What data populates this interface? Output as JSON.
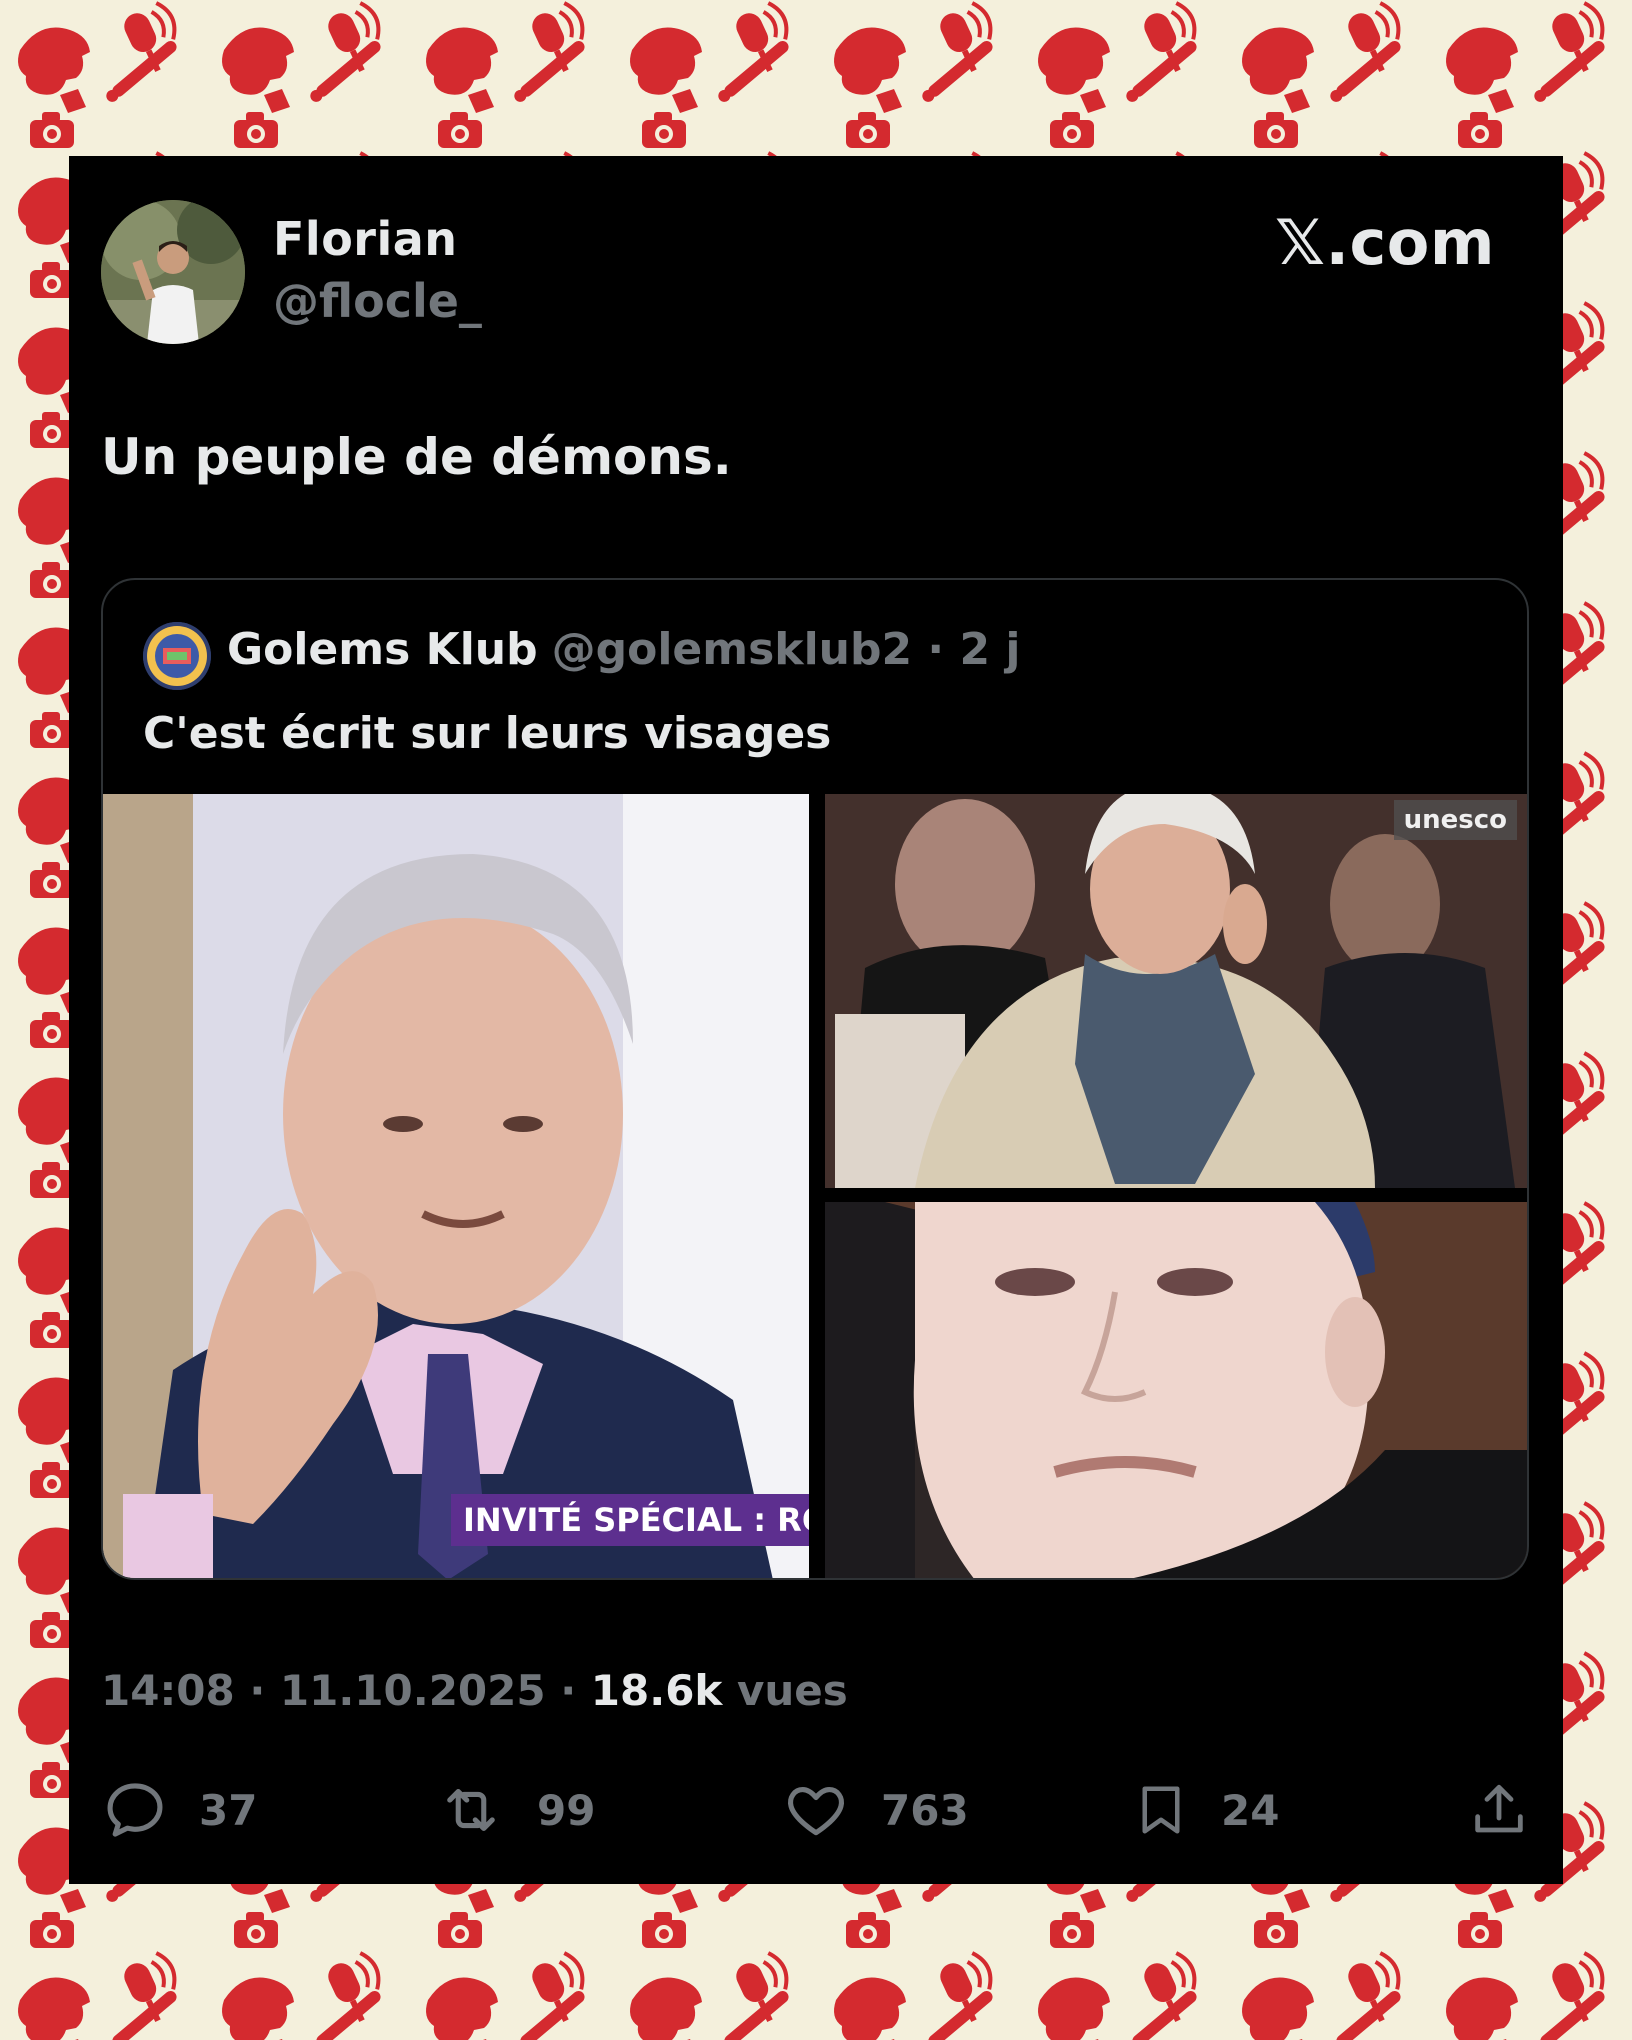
{
  "colors": {
    "card_background": "#000000",
    "text_primary": "#e7e9ea",
    "text_secondary": "#71767b",
    "pattern_background": "#f4f0dc",
    "pattern_icons": "#d42a2f"
  },
  "background_pattern": {
    "icon_names": [
      "trump-head-icon",
      "microphone-icon",
      "baseball-bat-icon",
      "camera-icon"
    ]
  },
  "tweet": {
    "author": {
      "name": "Florian",
      "handle": "@flocle_"
    },
    "brand": "𝕏.com",
    "text": "Un peuple de démons.",
    "quoted_tweet": {
      "author_name": "Golems Klub",
      "meta": "@golemsklub2 · 2 j",
      "text": "C'est écrit sur leurs visages",
      "media": [
        {
          "description_icon": "elderly-man-photo",
          "caption": "INVITÉ SPÉCIAL : ROI"
        },
        {
          "description_icon": "elderly-woman-photo",
          "watermark": "unesco"
        },
        {
          "description_icon": "woman-closeup-photo"
        }
      ]
    },
    "timestamp": "14:08 · 11.10.2025 · ",
    "views_count": "18.6k",
    "views_label": " vues",
    "actions": {
      "replies": "37",
      "reposts": "99",
      "likes": "763",
      "bookmarks": "24"
    }
  }
}
